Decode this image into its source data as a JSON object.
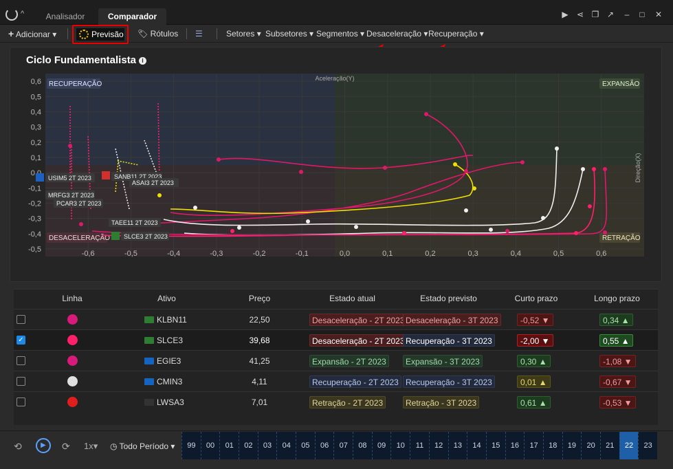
{
  "tabs": [
    {
      "label": "Analisador"
    },
    {
      "label": "Comparador"
    }
  ],
  "toolbar": {
    "add_label": "Adicionar",
    "forecast_label": "Previsão",
    "labels_label": "Rótulos",
    "filters": [
      "Setores",
      "Subsetores",
      "Segmentos",
      "Desaceleração",
      "Recuperação"
    ]
  },
  "chart": {
    "title": "Ciclo Fundamentalista",
    "y_axis_label": "Aceleração(Y)",
    "x_axis_label": "Direção(X)",
    "quadrants": {
      "top_left": "RECUPERAÇÃO",
      "top_right": "EXPANSÃO",
      "bottom_left": "DESACELERAÇÃO",
      "bottom_right": "RETRAÇÃO"
    },
    "y_ticks": [
      "0,6",
      "0,5",
      "0,4",
      "0,3",
      "0,2",
      "0,1",
      "0,0",
      "-0,1",
      "-0,2",
      "-0,3",
      "-0,4",
      "-0,5"
    ],
    "x_ticks": [
      "-0,6",
      "-0,5",
      "-0,4",
      "-0,3",
      "-0,2",
      "-0,1",
      "0,0",
      "0,1",
      "0,2",
      "0,3",
      "0,4",
      "0,5",
      "0,6"
    ],
    "point_labels": [
      "USIM5 2T 2023",
      "MRFG3 2T 2023",
      "PCAR3 2T 2023",
      "SANB11 2T 2023",
      "ASAI3 2T 2023",
      "TAEE11 2T 2023",
      "SLCE3 2T 2023"
    ]
  },
  "chart_data": {
    "type": "scatter",
    "xlim": [
      -0.7,
      0.7
    ],
    "ylim": [
      -0.55,
      0.65
    ],
    "xlabel": "Direção(X)",
    "ylabel": "Aceleração(Y)"
  },
  "table": {
    "headers": [
      "Linha",
      "Ativo",
      "Preço",
      "Estado atual",
      "Estado previsto",
      "Curto prazo",
      "Longo prazo"
    ],
    "rows": [
      {
        "checked": false,
        "color": "#d81b7a",
        "ticker": "KLBN11",
        "logo_color": "#2e7d32",
        "price": "22,50",
        "current": "Desaceleração - 2T 2023",
        "current_type": "des",
        "forecast": "Desaceleração - 3T 2023",
        "forecast_type": "des",
        "short": "-0,52 ▼",
        "short_type": "red",
        "long": "0,34 ▲",
        "long_type": "grn"
      },
      {
        "checked": true,
        "color": "#ff1f6a",
        "ticker": "SLCE3",
        "logo_color": "#2e7d32",
        "price": "39,68",
        "current": "Desaceleração - 2T 2023",
        "current_type": "des",
        "forecast": "Recuperação - 3T 2023",
        "forecast_type": "rec",
        "short": "-2,00 ▼",
        "short_type": "redb",
        "long": "0,55 ▲",
        "long_type": "grnb"
      },
      {
        "checked": false,
        "color": "#d81b7a",
        "ticker": "EGIE3",
        "logo_color": "#1565c0",
        "price": "41,25",
        "current": "Expansão - 2T 2023",
        "current_type": "exp",
        "forecast": "Expansão - 3T 2023",
        "forecast_type": "exp",
        "short": "0,30 ▲",
        "short_type": "grn",
        "long": "-1,08 ▼",
        "long_type": "red"
      },
      {
        "checked": false,
        "color": "#e0e0e0",
        "ticker": "CMIN3",
        "logo_color": "#1565c0",
        "price": "4,11",
        "current": "Recuperação - 2T 2023",
        "current_type": "rec",
        "forecast": "Recuperação - 3T 2023",
        "forecast_type": "rec",
        "short": "0,01 ▲",
        "short_type": "yel",
        "long": "-0,67 ▼",
        "long_type": "red"
      },
      {
        "checked": false,
        "color": "#e01e1e",
        "ticker": "LWSA3",
        "logo_color": "#333333",
        "price": "7,01",
        "current": "Retração - 2T 2023",
        "current_type": "ret",
        "forecast": "Retração - 3T 2023",
        "forecast_type": "ret",
        "short": "0,61 ▲",
        "short_type": "grn",
        "long": "-0,53 ▼",
        "long_type": "red"
      }
    ]
  },
  "bottom": {
    "speed": "1x",
    "period": "Todo Período",
    "timeline": [
      "99",
      "00",
      "01",
      "02",
      "03",
      "04",
      "05",
      "06",
      "07",
      "08",
      "09",
      "10",
      "11",
      "12",
      "13",
      "14",
      "15",
      "16",
      "17",
      "18",
      "19",
      "20",
      "21",
      "22",
      "23"
    ],
    "selected": "22"
  }
}
